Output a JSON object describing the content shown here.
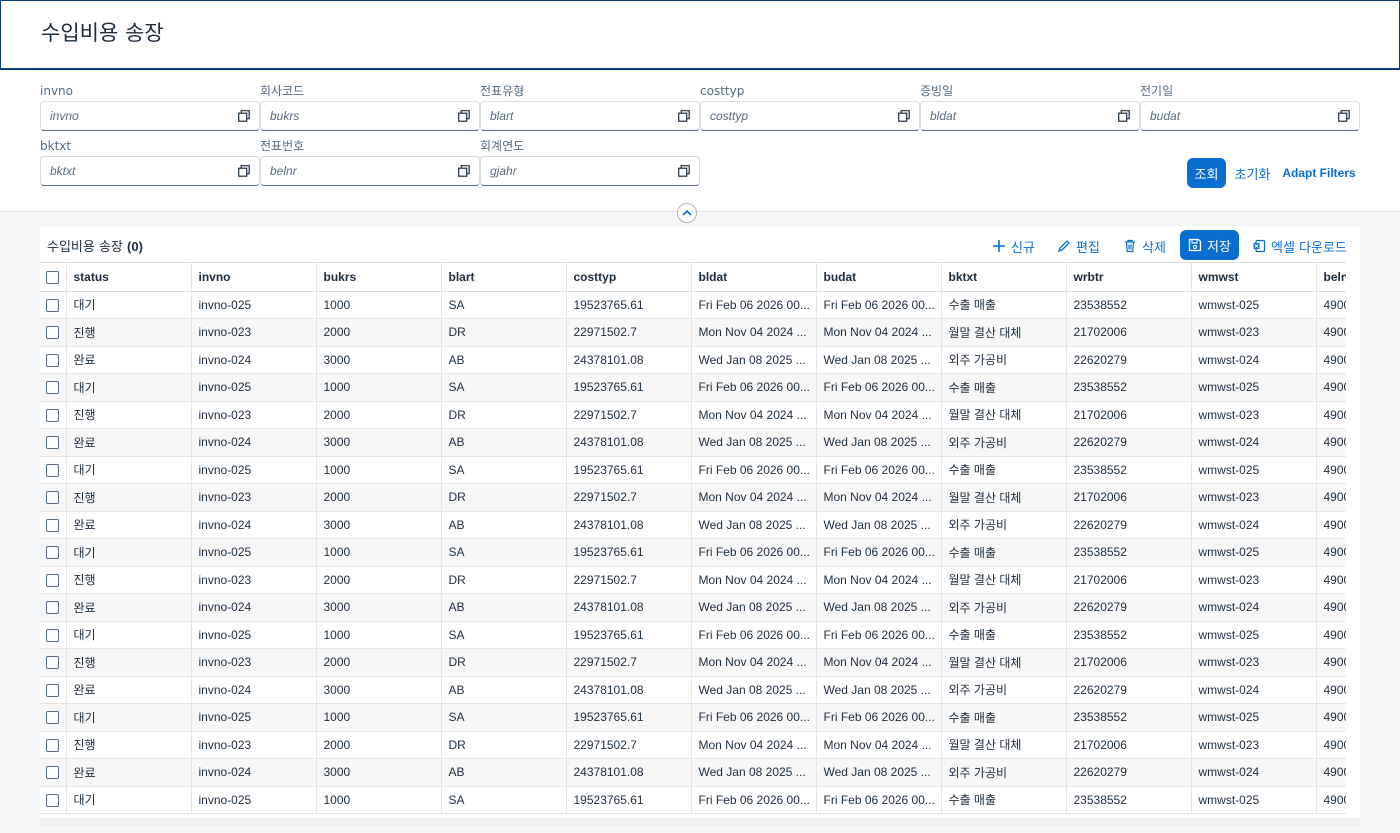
{
  "header": {
    "title": "수입비용 송장"
  },
  "filters": [
    {
      "label": "invno",
      "placeholder": "invno"
    },
    {
      "label": "회사코드",
      "placeholder": "bukrs"
    },
    {
      "label": "전표유형",
      "placeholder": "blart"
    },
    {
      "label": "costtyp",
      "placeholder": "costtyp"
    },
    {
      "label": "증빙일",
      "placeholder": "bldat"
    },
    {
      "label": "전기일",
      "placeholder": "budat"
    },
    {
      "label": "bktxt",
      "placeholder": "bktxt"
    },
    {
      "label": "전표번호",
      "placeholder": "belnr"
    },
    {
      "label": "회계연도",
      "placeholder": "gjahr"
    }
  ],
  "filter_actions": {
    "go": "조회",
    "reset": "초기화",
    "adapt": "Adapt Filters"
  },
  "table": {
    "title": "수입비용 송장",
    "count": "(0)",
    "toolbar": {
      "new": "신규",
      "edit": "편집",
      "delete": "삭제",
      "save": "저장",
      "excel": "엑셀 다운로드"
    },
    "columns": [
      "status",
      "invno",
      "bukrs",
      "blart",
      "costtyp",
      "bldat",
      "budat",
      "bktxt",
      "wrbtr",
      "wmwst",
      "beln"
    ],
    "row_templates": [
      [
        "대기",
        "invno-025",
        "1000",
        "SA",
        "19523765.61",
        "Fri Feb 06 2026 00...",
        "Fri Feb 06 2026 00...",
        "수출 매출",
        "23538552",
        "wmwst-025",
        "4900"
      ],
      [
        "진행",
        "invno-023",
        "2000",
        "DR",
        "22971502.7",
        "Mon Nov 04 2024 ...",
        "Mon Nov 04 2024 ...",
        "월말 결산 대체",
        "21702006",
        "wmwst-023",
        "4900"
      ],
      [
        "완료",
        "invno-024",
        "3000",
        "AB",
        "24378101.08",
        "Wed Jan 08 2025 ...",
        "Wed Jan 08 2025 ...",
        "외주 가공비",
        "22620279",
        "wmwst-024",
        "4900"
      ]
    ],
    "row_count": 19
  }
}
